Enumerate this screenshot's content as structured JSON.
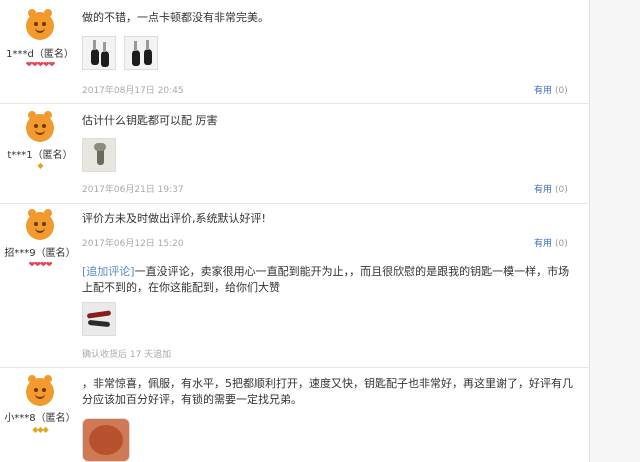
{
  "reviews": [
    {
      "user": "1***d（匿名）",
      "badges": "❤❤❤❤❤",
      "text": "做的不错，一点卡顿都没有非常完美。",
      "date": "2017年08月17日 20:45",
      "useful_label": "有用",
      "useful_count": "(0)"
    },
    {
      "user": "t***1（匿名）",
      "badges": "◆",
      "text": "估计什么钥匙都可以配 厉害",
      "date": "2017年06月21日 19:37",
      "useful_label": "有用",
      "useful_count": "(0)"
    },
    {
      "user": "招***9（匿名）",
      "badges": "❤❤❤❤",
      "text": "评价方未及时做出评价,系统默认好评!",
      "date": "2017年06月12日 15:20",
      "useful_label": "有用",
      "useful_count": "(0)",
      "follow_label": "[追加评论]",
      "follow_line1": "一直没评论，卖家很用心一直配到能开为止，，而且很欣慰的是跟我的钥匙一模一样，市场",
      "follow_line2": "上配不到的，在你这能配到，给你们大赞",
      "follow_note": "确认收货后 17 天追加"
    },
    {
      "user": "小***8（匿名）",
      "badges": "◆◆◆",
      "text_line1": "，非常惊喜，佩服，有水平，5把都顺利打开，速度又快，钥匙配子也非常好，再这里谢了，好评有几",
      "text_line2": "分应该加百分好评，有锁的需要一定找兄弟。"
    }
  ]
}
